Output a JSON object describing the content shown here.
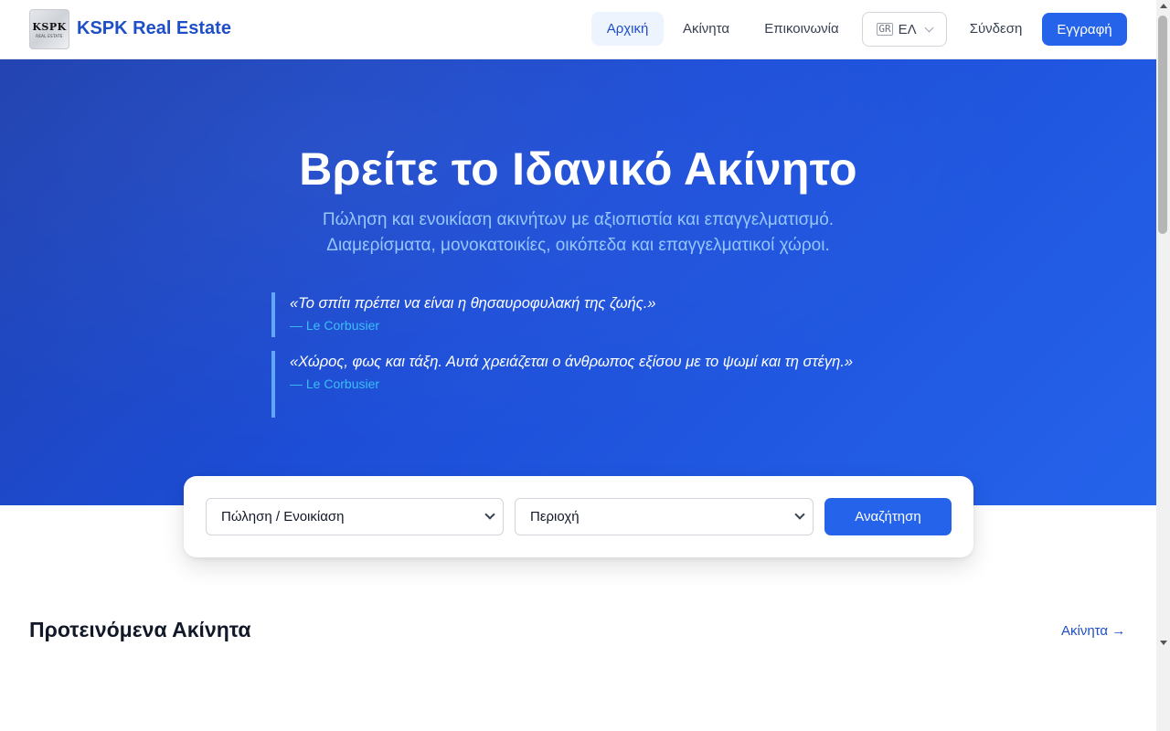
{
  "header": {
    "logo": {
      "line1": "KSPK",
      "line2": "REAL ESTATE"
    },
    "brand": "KSPK Real Estate",
    "nav": [
      {
        "label": "Αρχική"
      },
      {
        "label": "Ακίνητα"
      },
      {
        "label": "Επικοινωνία"
      }
    ],
    "language": {
      "flag": "GR",
      "code": "ΕΛ"
    },
    "login": "Σύνδεση",
    "register": "Εγγραφή"
  },
  "hero": {
    "title": "Βρείτε το Ιδανικό Ακίνητο",
    "subtitle_line1": "Πώληση και ενοικίαση ακινήτων με αξιοπιστία και επαγγελματισμό.",
    "subtitle_line2": "Διαμερίσματα, μονοκατοικίες, οικόπεδα και επαγγελματικοί χώροι.",
    "quotes": [
      {
        "text": "«Το σπίτι πρέπει να είναι η θησαυροφυλακή της ζωής.»",
        "author": "— Le Corbusier"
      },
      {
        "text": "«Χώρος, φως και τάξη. Αυτά χρειάζεται ο άνθρωπος εξίσου με το ψωμί και τη στέγη.»",
        "author": "— Le Corbusier"
      }
    ]
  },
  "search": {
    "type_select": "Πώληση / Ενοικίαση",
    "area_select": "Περιοχή",
    "button": "Αναζήτηση"
  },
  "featured": {
    "title": "Προτεινόμενα Ακίνητα",
    "link": "Ακίνητα →"
  },
  "colors": {
    "primary": "#2563eb",
    "brand_text": "#1e4fc7",
    "hero_subtitle": "#93c5fd",
    "quote_author": "#38bdf8"
  }
}
